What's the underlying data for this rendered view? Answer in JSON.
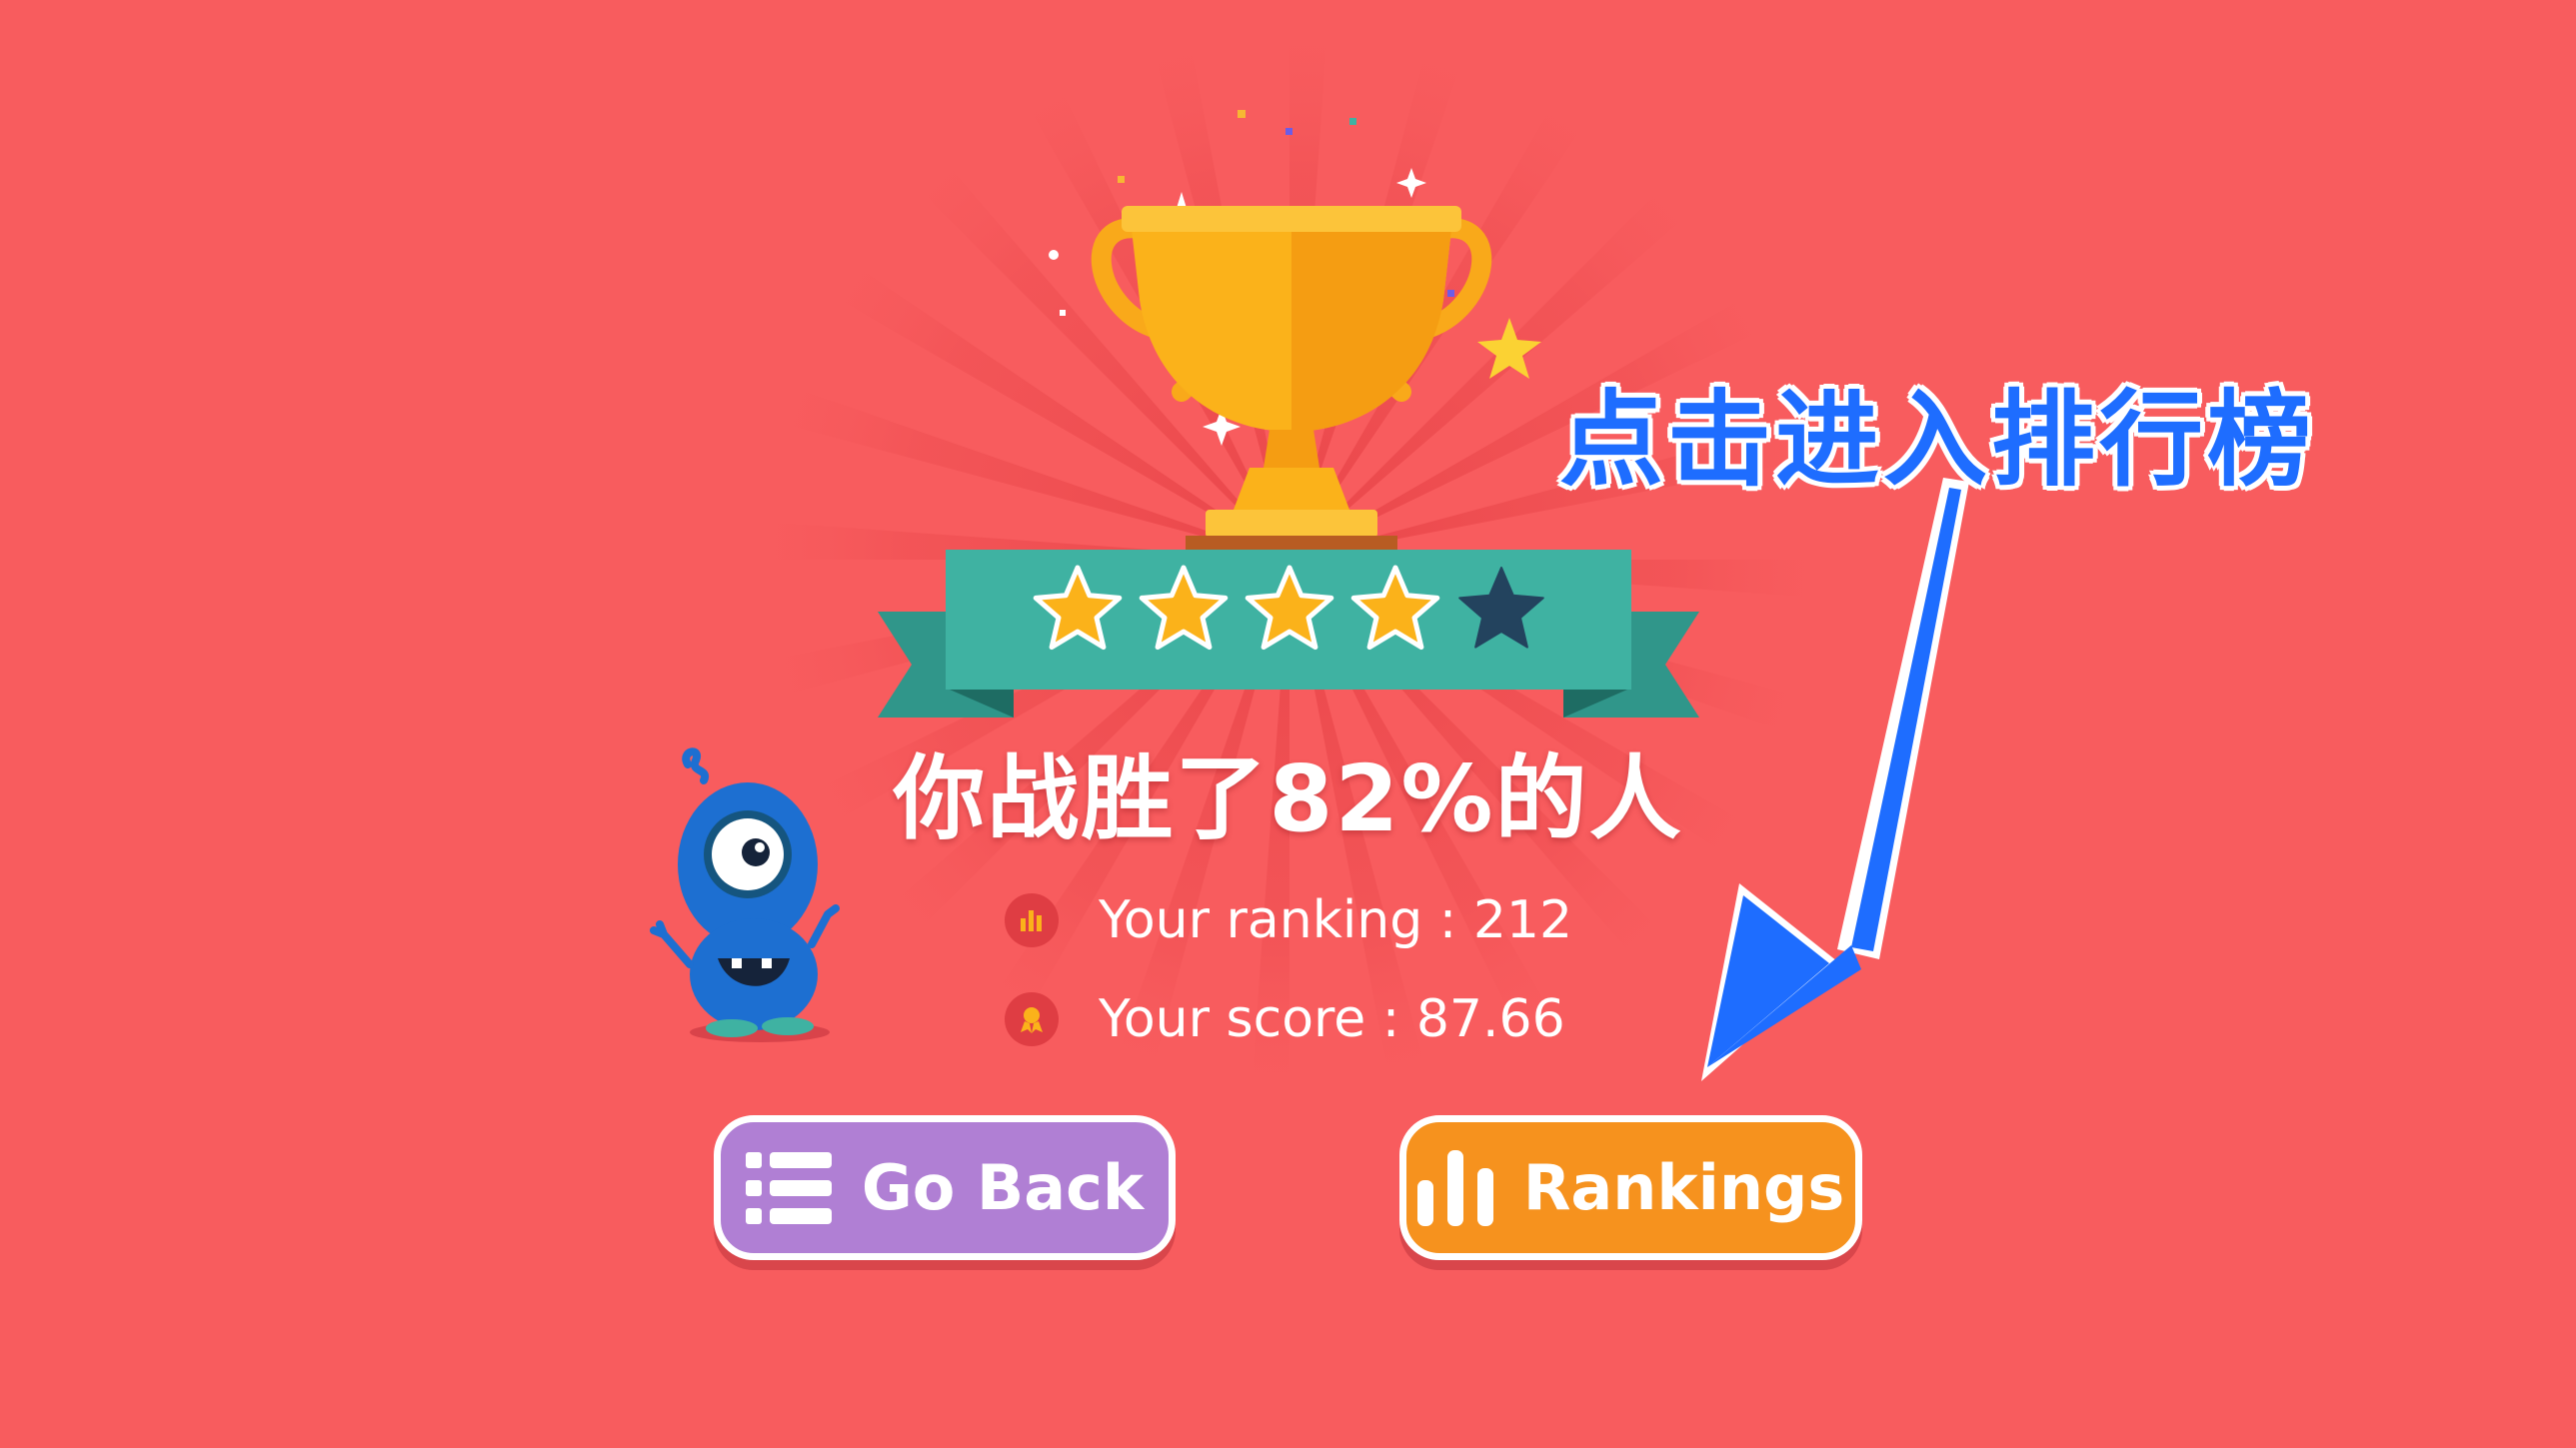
{
  "result": {
    "prefix": "你战胜了",
    "percent": "82%",
    "suffix": "的人"
  },
  "stats": {
    "ranking_text": "Your ranking : 212",
    "score_text": "Your score : 87.66",
    "ranking_value": 212,
    "score_value": 87.66
  },
  "stars": {
    "earned": 4,
    "total": 5
  },
  "buttons": {
    "back_label": "Go Back",
    "rankings_label": "Rankings"
  },
  "annotation": {
    "text": "点击进入排行榜"
  },
  "colors": {
    "background": "#f85c5e",
    "ribbon": "#3fb2a2",
    "back_button": "#b07fd4",
    "rankings_button": "#f6921e",
    "annotation": "#1e6dff",
    "trophy": "#fbb21a"
  },
  "icons": {
    "ranking": "bar-chart-icon",
    "score": "medal-icon",
    "back": "list-icon",
    "rankings": "bar-chart-icon"
  }
}
